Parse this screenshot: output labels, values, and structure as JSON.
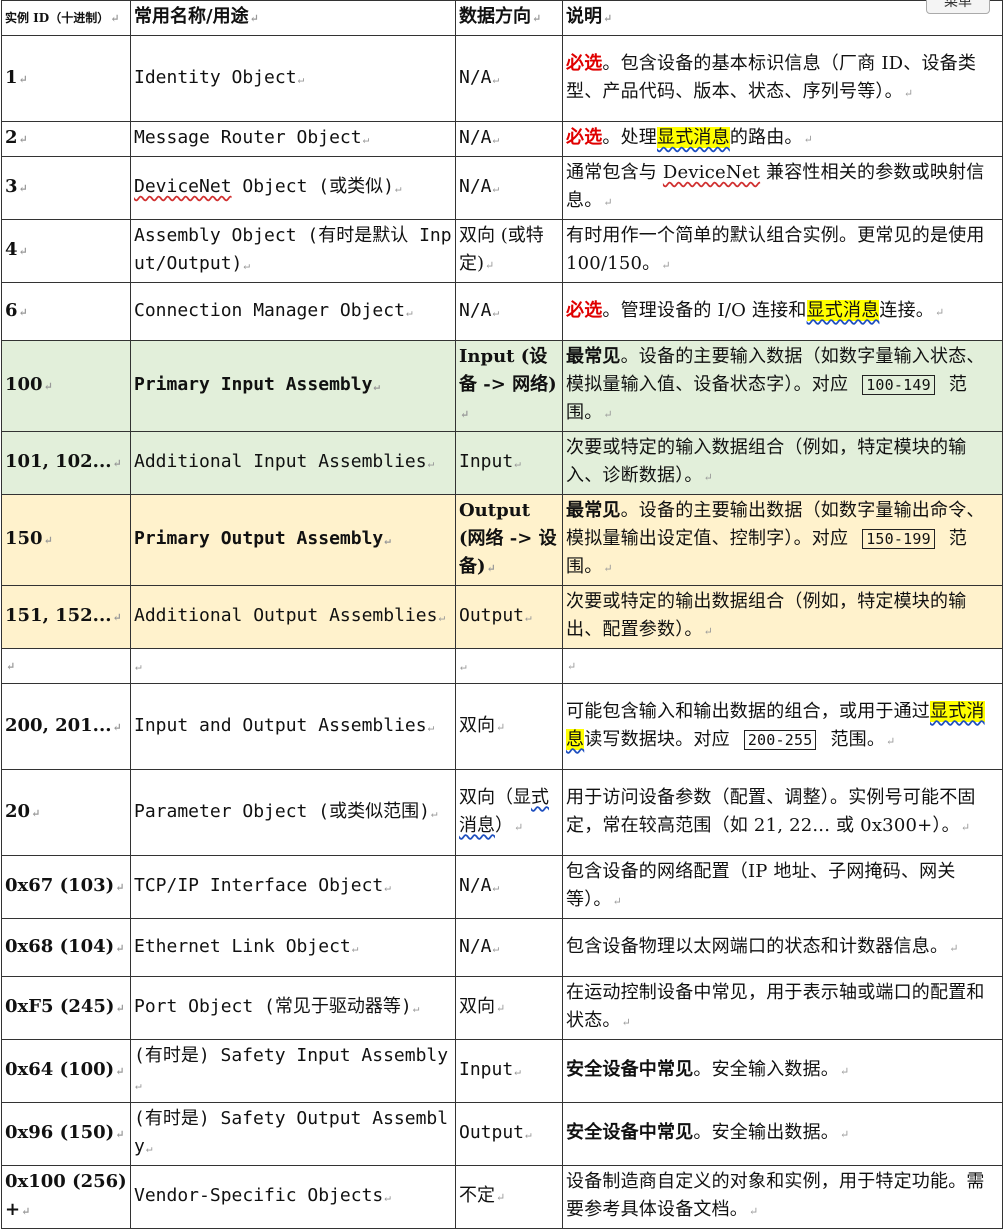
{
  "menu_label": "菜单",
  "headers": {
    "id": "实例 ID（十进制）",
    "name": "常用名称/用途",
    "dir": "数据方向",
    "desc": "说明"
  },
  "rows": [
    {
      "id": "1",
      "name": "Identity Object",
      "dir": "N/A",
      "req": "必选",
      "desc": "。包含设备的基本标识信息（厂商 ID、设备类型、产品代码、版本、状态、序列号等）。"
    },
    {
      "id": "2",
      "name": "Message Router Object",
      "dir": "N/A",
      "req": "必选",
      "desc_a": "。处理",
      "hl": "显式消息",
      "desc_b": "的路由。"
    },
    {
      "id": "3",
      "name_u": "DeviceNet",
      "name_rest": " Object (或类似)",
      "dir": "N/A",
      "desc_a": "通常包含与 ",
      "desc_u": "DeviceNet",
      "desc_b": " 兼容性相关的参数或映射信息。"
    },
    {
      "id": "4",
      "name": "Assembly Object (有时是默认 Input/Output)",
      "dir": "双向 (或特定)",
      "desc": "有时用作一个简单的默认组合实例。更常见的是使用 100/150。"
    },
    {
      "id": "6",
      "name": "Connection Manager Object",
      "dir": "N/A",
      "req": "必选",
      "desc_a": "。管理设备的 I/O 连接和",
      "hl": "显式消息",
      "desc_b": "连接。"
    },
    {
      "id": "100",
      "name": "Primary Input Assembly",
      "dir": "Input (设备 -> 网络)",
      "lead": "最常见",
      "desc_a": "。设备的主要输入数据（如数字量输入状态、模拟量输入值、设备状态字）。对应",
      "range": "100-149",
      "desc_b": "范围。"
    },
    {
      "id": "101, 102...",
      "name": "Additional Input Assemblies",
      "dir": "Input",
      "desc": "次要或特定的输入数据组合（例如，特定模块的输入、诊断数据）。"
    },
    {
      "id": "150",
      "name": "Primary Output Assembly",
      "dir": "Output (网络 -> 设备)",
      "lead": "最常见",
      "desc_a": "。设备的主要输出数据（如数字量输出命令、模拟量输出设定值、控制字）。对应",
      "range": "150-199",
      "desc_b": "范围。"
    },
    {
      "id": "151, 152...",
      "name": "Additional Output Assemblies",
      "dir": "Output",
      "desc": "次要或特定的输出数据组合（例如，特定模块的输出、配置参数）。"
    },
    {
      "id": "",
      "name": "",
      "dir": "",
      "desc": ""
    },
    {
      "id": "200, 201...",
      "name": "Input and Output Assemblies",
      "dir": "双向",
      "desc_a": "可能包含输入和输出数据的组合，或用于通过",
      "hl": "显式消息",
      "desc_b": "读写数据块。对应",
      "range": "200-255",
      "desc_c": "范围。"
    },
    {
      "id": "20",
      "name": "Parameter Object (或类似范围)",
      "dir_a": "双向（显",
      "dir_u": "式消息",
      "dir_b": "）",
      "desc": "用于访问设备参数（配置、调整）。实例号可能不固定，常在较高范围（如 21, 22... 或 0x300+）。"
    },
    {
      "id": "0x67 (103)",
      "name": "TCP/IP Interface Object",
      "dir": "N/A",
      "desc": "包含设备的网络配置（IP 地址、子网掩码、网关等）。"
    },
    {
      "id": "0x68 (104)",
      "name": "Ethernet Link Object",
      "dir": "N/A",
      "desc": "包含设备物理以太网端口的状态和计数器信息。"
    },
    {
      "id": "0xF5 (245)",
      "name": "Port Object (常见于驱动器等)",
      "dir": "双向",
      "desc": "在运动控制设备中常见，用于表示轴或端口的配置和状态。"
    },
    {
      "id": "0x64 (100)",
      "name": "(有时是) Safety Input Assembly",
      "dir": "Input",
      "lead": "安全设备中常见",
      "desc": "。安全输入数据。"
    },
    {
      "id": "0x96 (150)",
      "name": "(有时是) Safety Output Assembly",
      "dir": "Output",
      "lead": "安全设备中常见",
      "desc": "。安全输出数据。"
    },
    {
      "id": "0x100 (256)+",
      "name": "Vendor-Specific Objects",
      "dir": "不定",
      "desc": "设备制造商自定义的对象和实例，用于特定功能。需要参考具体设备文档。"
    }
  ]
}
